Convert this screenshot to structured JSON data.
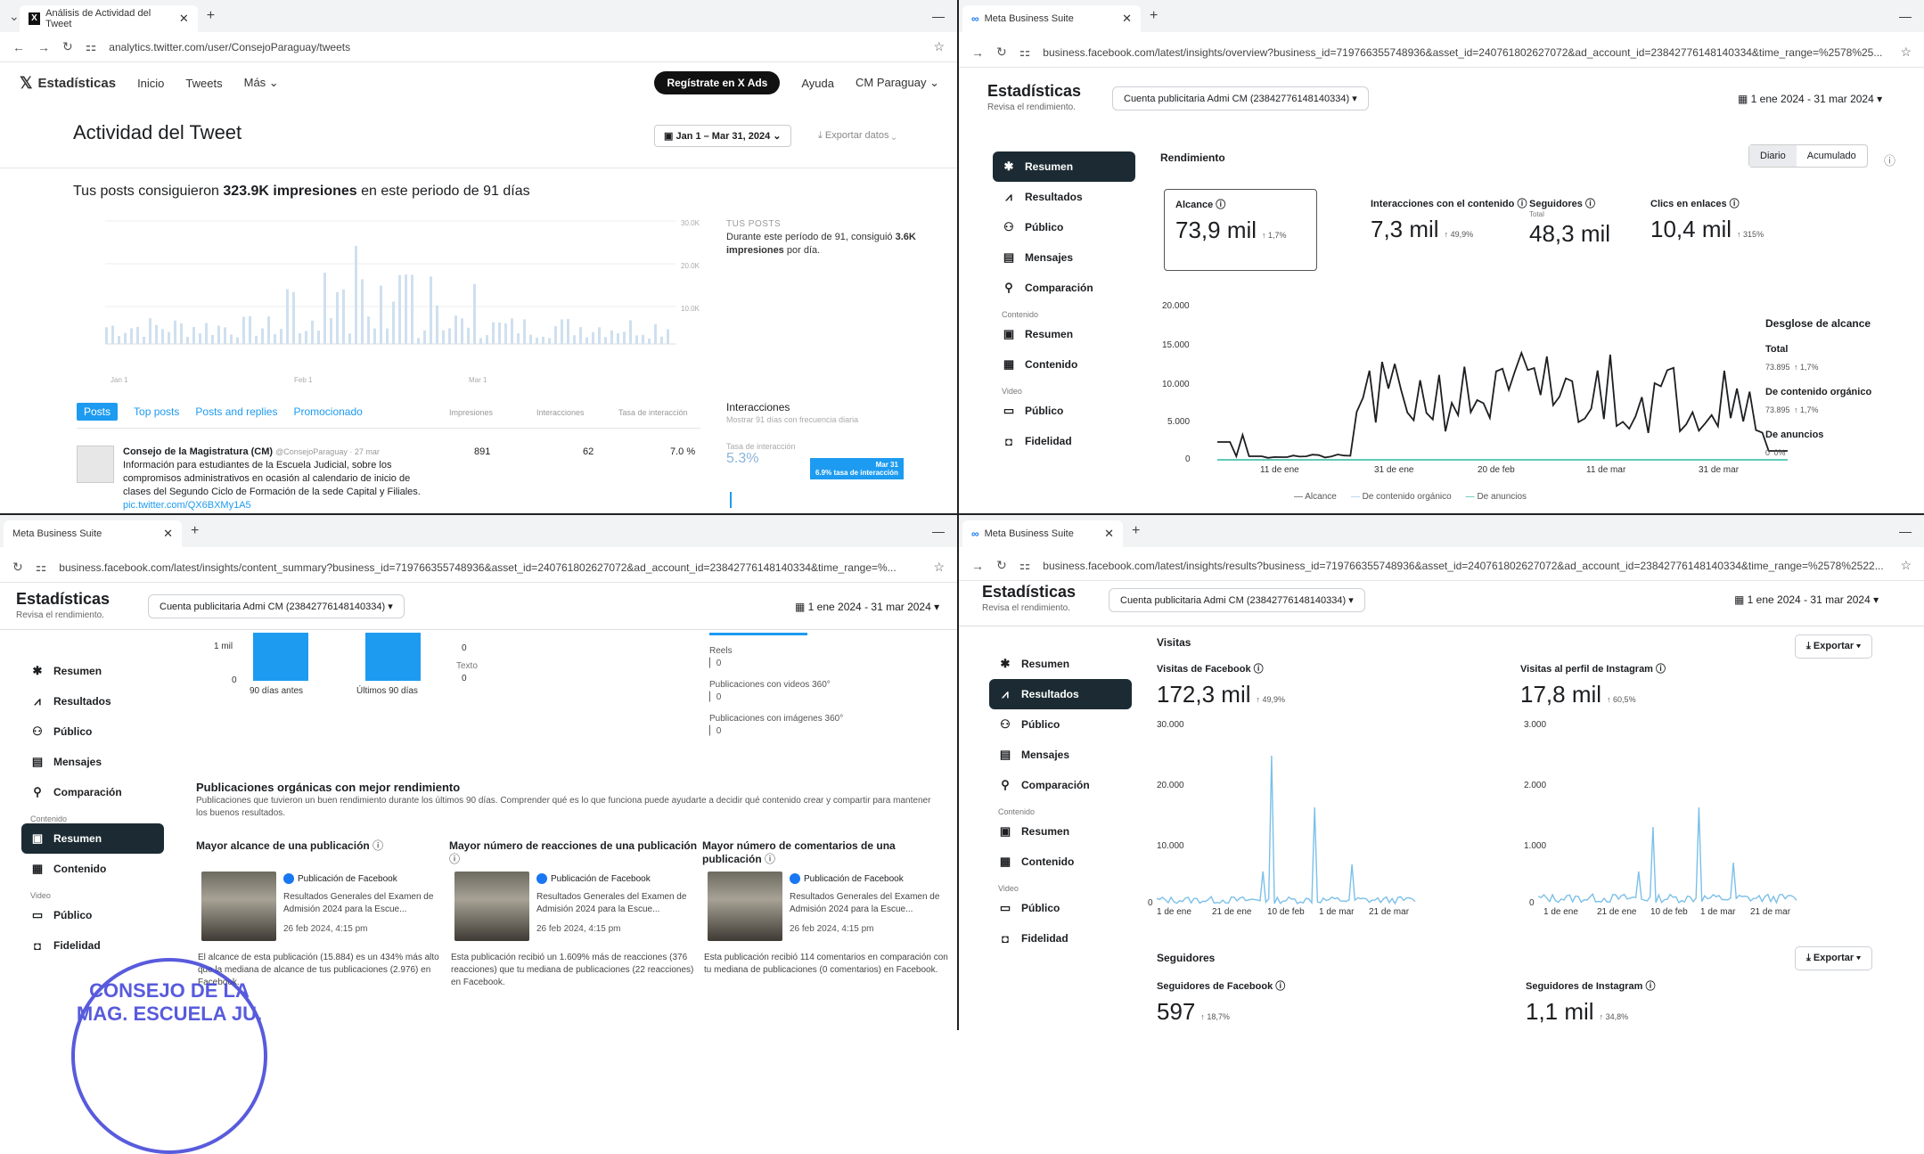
{
  "twitter": {
    "tab_title": "Análisis de Actividad del Tweet",
    "url": "analytics.twitter.com/user/ConsejoParaguay/tweets",
    "brand": "Estadísticas",
    "nav": [
      "Inicio",
      "Tweets",
      "Más"
    ],
    "ads_button": "Regístrate en X Ads",
    "help": "Ayuda",
    "account": "CM Paraguay",
    "title": "Actividad del Tweet",
    "date_range": "Jan 1 – Mar 31, 2024",
    "export": "Exportar datos",
    "summary_pre": "Tus posts consiguieron",
    "summary_bold": "323.9K impresiones",
    "summary_post": "en este periodo de 91 días",
    "tposts_head": "TUS POSTS",
    "tposts_text_pre": "Durante este período de 91, consiguió",
    "tposts_bold": "3.6K impresiones",
    "tposts_text_post": "por día.",
    "y_ticks": [
      "30.0K",
      "20.0K",
      "10.0K"
    ],
    "x_ticks": [
      "Jan 1",
      "Feb 1",
      "Mar 1"
    ],
    "tabs": [
      "Posts",
      "Top posts",
      "Posts and replies",
      "Promocionado"
    ],
    "cols": [
      "Impresiones",
      "Interacciones",
      "Tasa de interacción"
    ],
    "tweet": {
      "author": "Consejo de la Magistratura (CM)",
      "handle": "@ConsejoParaguay · 27 mar",
      "text": "Información para estudiantes de la Escuela Judicial, sobre los compromisos administrativos en ocasión al calendario de inicio de clases del Segundo Ciclo de Formación de la sede Capital y Filiales.",
      "link": "pic.twitter.com/QX6BXMy1A5",
      "impressions": "891",
      "interactions": "62",
      "rate": "7.0 %"
    },
    "interactions_title": "Interacciones",
    "interactions_sub": "Mostrar 91 días con frecuencia diaria",
    "rate_label": "Tasa de interacción",
    "rate_value": "5.3%",
    "tooltip_date": "Mar 31",
    "tooltip_value": "6.9% tasa de interacción"
  },
  "meta_common": {
    "tab_title": "Meta Business Suite",
    "title": "Estadísticas",
    "subtitle": "Revisa el rendimiento.",
    "account": "Cuenta publicitaria Admi CM (23842776148140334)",
    "date": "1 ene 2024 - 31 mar 2024",
    "nav": {
      "resumen": "Resumen",
      "resultados": "Resultados",
      "publico": "Público",
      "mensajes": "Mensajes",
      "comparacion": "Comparación",
      "contenido_sec": "Contenido",
      "resumen2": "Resumen",
      "contenido": "Contenido",
      "video_sec": "Video",
      "publico2": "Público",
      "fidelidad": "Fidelidad"
    }
  },
  "meta_overview": {
    "url": "business.facebook.com/latest/insights/overview?business_id=719766355748936&asset_id=240761802627072&ad_account_id=23842776148140334&time_range=%2578%25...",
    "section": "Rendimiento",
    "seg": [
      "Diario",
      "Acumulado"
    ],
    "kpis": [
      {
        "label": "Alcance",
        "value": "73,9 mil",
        "delta": "↑ 1,7%"
      },
      {
        "label": "Interacciones con el contenido",
        "value": "7,3 mil",
        "delta": "↑ 49,9%"
      },
      {
        "label": "Seguidores",
        "sub": "Total",
        "value": "48,3 mil",
        "delta": ""
      },
      {
        "label": "Clics en enlaces",
        "value": "10,4 mil",
        "delta": "↑ 315%"
      }
    ],
    "y_ticks": [
      "20.000",
      "15.000",
      "10.000",
      "5.000",
      "0"
    ],
    "x_ticks": [
      "11 de ene",
      "31 de ene",
      "20 de feb",
      "11 de mar",
      "31 de mar"
    ],
    "legend": [
      "Alcance",
      "De contenido orgánico",
      "De anuncios"
    ],
    "breakdown": {
      "title": "Desglose de alcance",
      "items": [
        {
          "name": "Total",
          "value": "73.895",
          "delta": "↑ 1,7%"
        },
        {
          "name": "De contenido orgánico",
          "value": "73.895",
          "delta": "↑ 1,7%"
        },
        {
          "name": "De anuncios",
          "value": "0",
          "delta": "0%"
        }
      ]
    }
  },
  "meta_content": {
    "url": "business.facebook.com/latest/insights/content_summary?business_id=719766355748936&asset_id=240761802627072&ad_account_id=23842776148140334&time_range=%...",
    "bars_y": [
      "1 mil",
      "0"
    ],
    "bars_x": [
      "90 días antes",
      "Últimos 90 días"
    ],
    "mini": [
      {
        "label": "Texto",
        "value": "0"
      }
    ],
    "mini_top": "0",
    "right_list": [
      {
        "label": "Reels",
        "value": "0"
      },
      {
        "label": "Publicaciones con videos 360°",
        "value": "0"
      },
      {
        "label": "Publicaciones con imágenes 360°",
        "value": "0"
      }
    ],
    "section_title": "Publicaciones orgánicas con mejor rendimiento",
    "section_desc": "Publicaciones que tuvieron un buen rendimiento durante los últimos 90 días. Comprender qué es lo que funciona puede ayudarte a decidir qué contenido crear y compartir para mantener los buenos resultados.",
    "cards": [
      {
        "head": "Mayor alcance de una publicación",
        "src": "Publicación de Facebook",
        "title": "Resultados Generales del Examen de Admisión 2024 para la Escue...",
        "date": "26 feb 2024, 4:15 pm",
        "body": "El alcance de esta publicación (15.884) es un 434% más alto que la mediana de alcance de tus publicaciones (2.976) en Facebook."
      },
      {
        "head": "Mayor número de reacciones de una publicación",
        "src": "Publicación de Facebook",
        "title": "Resultados Generales del Examen de Admisión 2024 para la Escue...",
        "date": "26 feb 2024, 4:15 pm",
        "body": "Esta publicación recibió un 1.609% más de reacciones (376 reacciones) que tu mediana de publicaciones (22 reacciones) en Facebook."
      },
      {
        "head": "Mayor número de comentarios de una publicación",
        "src": "Publicación de Facebook",
        "title": "Resultados Generales del Examen de Admisión 2024 para la Escue...",
        "date": "26 feb 2024, 4:15 pm",
        "body": "Esta publicación recibió 114 comentarios en comparación con tu mediana de publicaciones (0 comentarios) en Facebook."
      }
    ],
    "stamp": "CONSEJO DE LA MAG. ESCUELA JU."
  },
  "meta_results": {
    "url": "business.facebook.com/latest/insights/results?business_id=719766355748936&asset_id=240761802627072&ad_account_id=23842776148140334&time_range=%2578%2522...",
    "section": "Visitas",
    "export": "Exportar",
    "fb": {
      "label": "Visitas de Facebook",
      "value": "172,3 mil",
      "delta": "↑ 49,9%",
      "y": [
        "30.000",
        "20.000",
        "10.000",
        "0"
      ]
    },
    "ig": {
      "label": "Visitas al perfil de Instagram",
      "value": "17,8 mil",
      "delta": "↑ 60,5%",
      "y": [
        "3.000",
        "2.000",
        "1.000",
        "0"
      ]
    },
    "x_ticks": [
      "1 de ene",
      "21 de ene",
      "10 de feb",
      "1 de mar",
      "21 de mar"
    ],
    "followers_section": "Seguidores",
    "fb_followers": {
      "label": "Seguidores de Facebook",
      "value": "597",
      "delta": "↑ 18,7%"
    },
    "ig_followers": {
      "label": "Seguidores de Instagram",
      "value": "1,1 mil",
      "delta": "↑ 34,8%"
    }
  },
  "colors": {
    "fb_blue": "#1877f2",
    "tw_blue": "#1d9bf0",
    "dark_nav": "#1c2b33",
    "chart_line": "#1c1e21",
    "light_line": "#7cc0e8"
  }
}
